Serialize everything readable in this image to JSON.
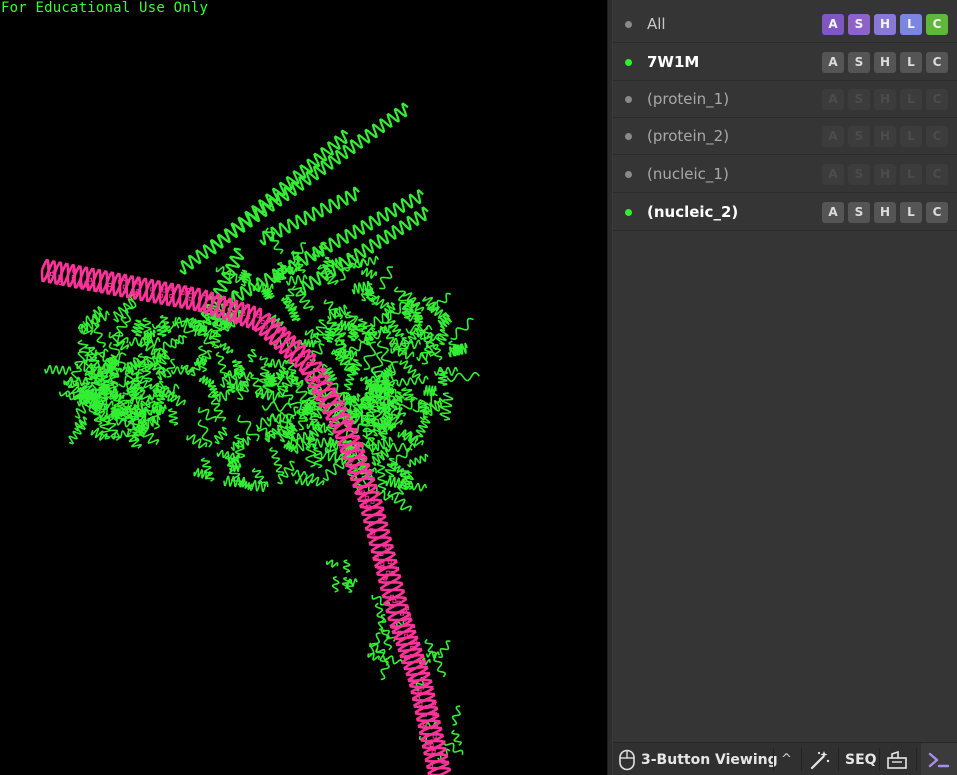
{
  "viewport": {
    "watermark": "For Educational Use Only"
  },
  "colors": {
    "protein": "#33ee33",
    "nucleic": "#ff3399",
    "enabled_dot": "#33ee33",
    "disabled_dot": "#8a8a8a",
    "btn_A_all": "#7e57c2",
    "btn_S_all": "#8e63c9",
    "btn_H_all": "#8a78d6",
    "btn_L_all": "#7b86e0",
    "btn_C_all": "#5fb83a"
  },
  "objects": [
    {
      "name": "All",
      "enabled": false,
      "style": "all"
    },
    {
      "name": "7W1M",
      "enabled": true,
      "style": "bold"
    },
    {
      "name": "(protein_1)",
      "enabled": false,
      "style": "dim"
    },
    {
      "name": "(protein_2)",
      "enabled": false,
      "style": "dim"
    },
    {
      "name": "(nucleic_1)",
      "enabled": false,
      "style": "dim"
    },
    {
      "name": "(nucleic_2)",
      "enabled": true,
      "style": "bold"
    }
  ],
  "buttons": [
    "A",
    "S",
    "H",
    "L",
    "C"
  ],
  "bottombar": {
    "mouse_mode": "3-Button Viewing",
    "caret": "^",
    "seq": "SEQ",
    "icons": [
      "mouse-icon",
      "magic-wand-icon",
      "builder-icon",
      "terminal-icon"
    ]
  }
}
